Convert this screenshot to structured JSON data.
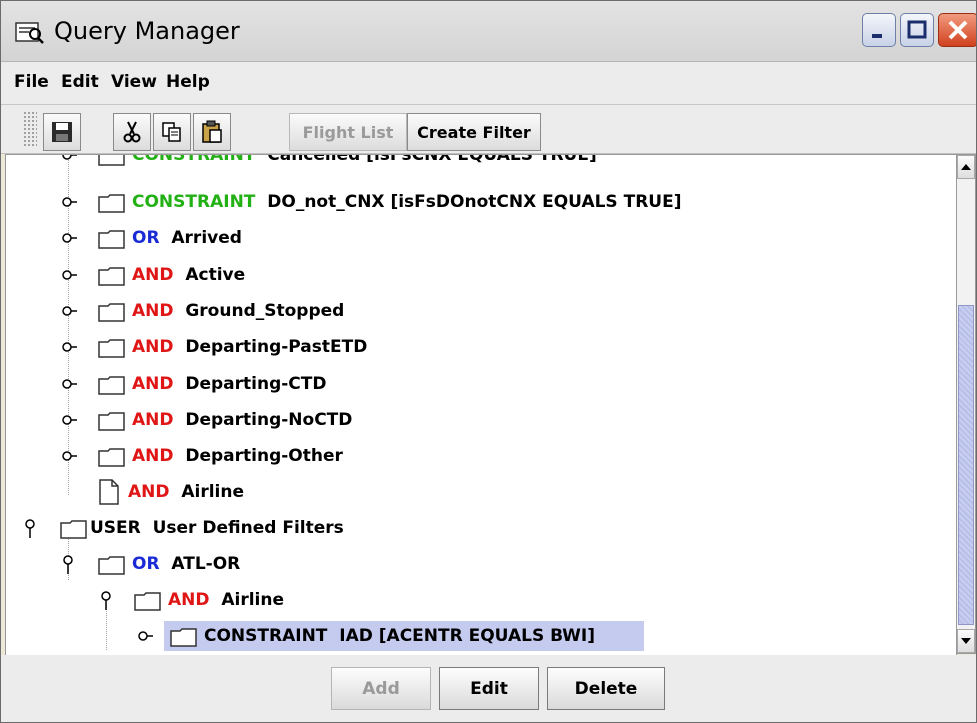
{
  "window": {
    "title": "Query Manager"
  },
  "menu": {
    "file": "File",
    "edit": "Edit",
    "view": "View",
    "help": "Help"
  },
  "toolbar": {
    "icons": [
      "save-icon",
      "cut-icon",
      "copy-icon",
      "paste-icon"
    ],
    "flight_list": "Flight List",
    "create_filter": "Create Filter"
  },
  "tree": {
    "rows": [
      {
        "keyword": "CONSTRAINT",
        "text": "Cancelled  [isFsCNX EQUALS TRUE]"
      },
      {
        "keyword": "CONSTRAINT",
        "text": "DO_not_CNX  [isFsDOnotCNX EQUALS TRUE]"
      },
      {
        "keyword": "OR",
        "text": "Arrived"
      },
      {
        "keyword": "AND",
        "text": "Active"
      },
      {
        "keyword": "AND",
        "text": "Ground_Stopped"
      },
      {
        "keyword": "AND",
        "text": "Departing-PastETD"
      },
      {
        "keyword": "AND",
        "text": "Departing-CTD"
      },
      {
        "keyword": "AND",
        "text": "Departing-NoCTD"
      },
      {
        "keyword": "AND",
        "text": "Departing-Other"
      },
      {
        "keyword": "AND",
        "text": "Airline"
      },
      {
        "keyword": "USER",
        "text": "User Defined Filters"
      },
      {
        "keyword": "OR",
        "text": "ATL-OR"
      },
      {
        "keyword": "AND",
        "text": "Airline"
      },
      {
        "keyword": "CONSTRAINT",
        "text": "IAD  [ACENTR EQUALS BWI]"
      }
    ]
  },
  "buttons": {
    "add": "Add",
    "edit": "Edit",
    "delete": "Delete"
  },
  "colors": {
    "constraint": "#22b014",
    "or": "#1a2bd6",
    "and": "#e01515",
    "selection": "#c5cbef"
  }
}
